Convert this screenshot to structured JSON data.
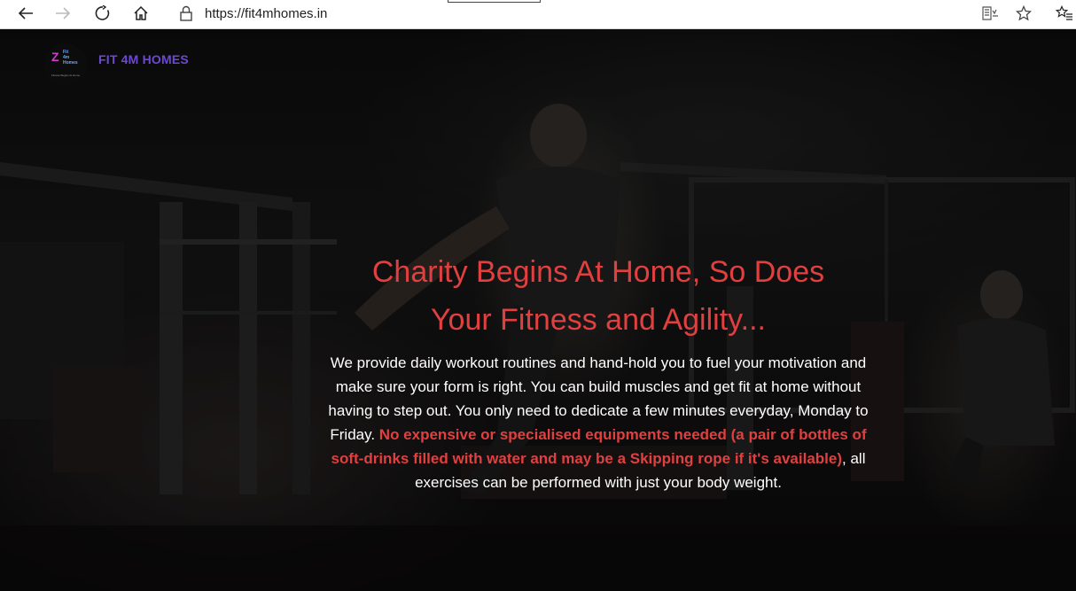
{
  "browser": {
    "url": "https://fit4mhomes.in",
    "icons": [
      "back-arrow-icon",
      "forward-arrow-icon",
      "refresh-icon",
      "home-icon",
      "lock-icon",
      "reader-mode-icon",
      "favorite-star-icon",
      "favorites-list-icon"
    ]
  },
  "site": {
    "logo": {
      "mark": "Z",
      "lines": [
        "Fit",
        "4m",
        "Homes"
      ],
      "tagline": "Fitness Begins At Home"
    },
    "brand_name": "FIT 4M HOMES"
  },
  "hero": {
    "headline_line1": "Charity Begins At Home, So Does",
    "headline_line2": "Your Fitness and Agility...",
    "description_part1": "We provide daily workout routines and hand-hold you to fuel your motivation and make sure your form is right. You can build muscles and get fit at home without having to step out. You only need to dedicate a few minutes everyday, Monday to Friday. ",
    "description_highlight": "No expensive or specialised equipments needed (a pair of bottles of soft-drinks filled with water and may be a Skipping rope if it's available)",
    "description_part2": ", all exercises can be performed with just your body weight."
  },
  "colors": {
    "accent_red": "#e0403f",
    "brand_purple": "#6d48d6",
    "text_white": "#ffffff"
  }
}
